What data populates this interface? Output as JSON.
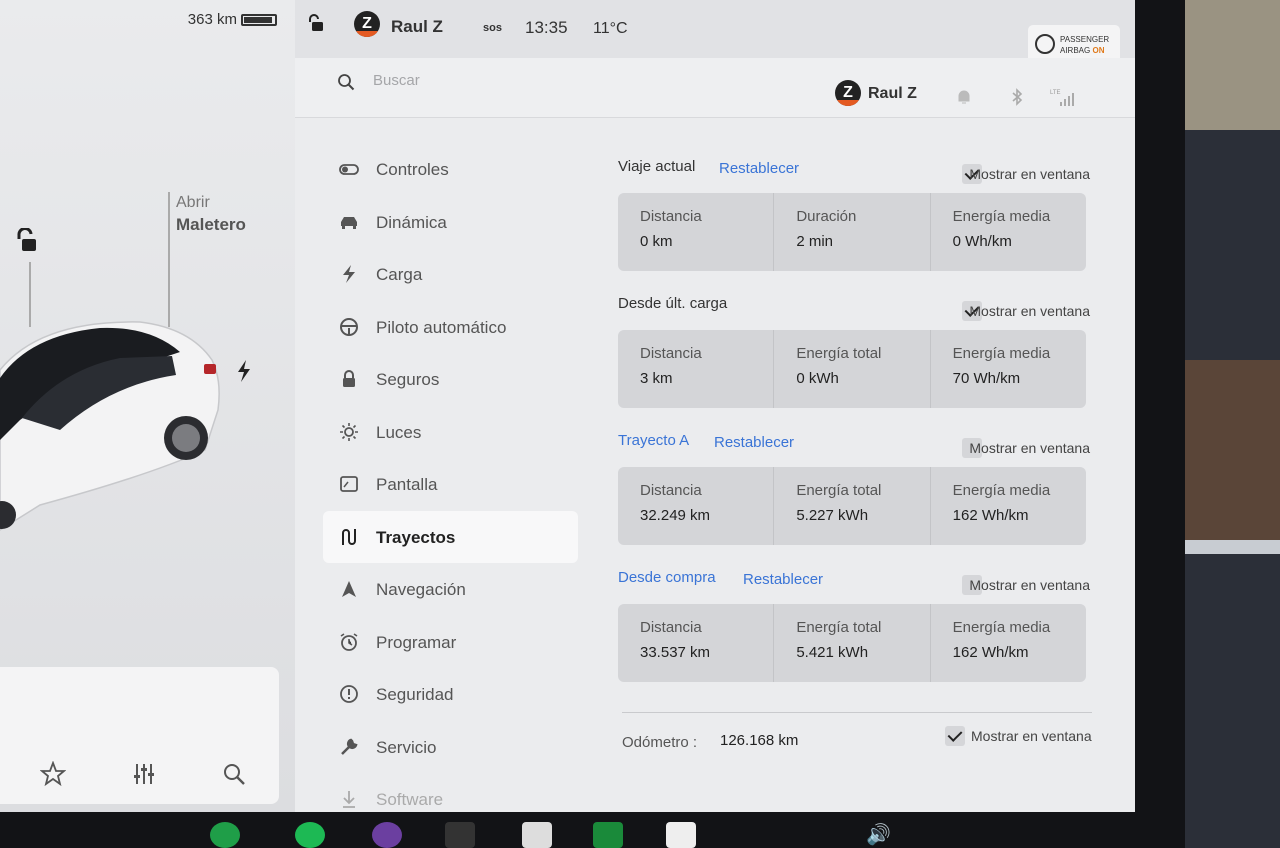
{
  "car_panel": {
    "range": "363 km",
    "trunk_label_top": "Abrir",
    "trunk_label_bottom": "Maletero"
  },
  "status_bar": {
    "user": "Raul Z",
    "sos": "sos",
    "time": "13:35",
    "temperature": "11°C",
    "airbag_line1": "PASSENGER",
    "airbag_line2": "AIRBAG",
    "airbag_state": "ON"
  },
  "search": {
    "placeholder": "Buscar",
    "user": "Raul Z",
    "signal_label": "LTE"
  },
  "nav": {
    "items": [
      {
        "label": "Controles",
        "icon": "toggle-icon"
      },
      {
        "label": "Dinámica",
        "icon": "car-icon"
      },
      {
        "label": "Carga",
        "icon": "bolt-icon"
      },
      {
        "label": "Piloto automático",
        "icon": "steering-wheel-icon"
      },
      {
        "label": "Seguros",
        "icon": "lock-icon"
      },
      {
        "label": "Luces",
        "icon": "light-icon"
      },
      {
        "label": "Pantalla",
        "icon": "display-icon"
      },
      {
        "label": "Trayectos",
        "icon": "trips-icon",
        "active": true
      },
      {
        "label": "Navegación",
        "icon": "navigation-icon"
      },
      {
        "label": "Programar",
        "icon": "alarm-clock-icon"
      },
      {
        "label": "Seguridad",
        "icon": "alert-icon"
      },
      {
        "label": "Servicio",
        "icon": "wrench-icon"
      },
      {
        "label": "Software",
        "icon": "download-icon"
      }
    ]
  },
  "trips": [
    {
      "title": "Viaje actual",
      "reset": "Restablecer",
      "show_label": "Mostrar en ventana",
      "show_checked": true,
      "stats": [
        {
          "label": "Distancia",
          "value": "0  km"
        },
        {
          "label": "Duración",
          "value": "2  min"
        },
        {
          "label": "Energía media",
          "value": "0  Wh/km"
        }
      ]
    },
    {
      "title": "Desde últ. carga",
      "show_label": "Mostrar en ventana",
      "show_checked": true,
      "stats": [
        {
          "label": "Distancia",
          "value": "3  km"
        },
        {
          "label": "Energía total",
          "value": "0  kWh"
        },
        {
          "label": "Energía media",
          "value": "70  Wh/km"
        }
      ]
    },
    {
      "title": "Trayecto A",
      "reset": "Restablecer",
      "show_label": "Mostrar en ventana",
      "show_checked": false,
      "stats": [
        {
          "label": "Distancia",
          "value": "32.249  km"
        },
        {
          "label": "Energía total",
          "value": "5.227  kWh"
        },
        {
          "label": "Energía media",
          "value": "162  Wh/km"
        }
      ]
    },
    {
      "title": "Desde compra",
      "reset": "Restablecer",
      "show_label": "Mostrar en ventana",
      "show_checked": false,
      "stats": [
        {
          "label": "Distancia",
          "value": "33.537  km"
        },
        {
          "label": "Energía total",
          "value": "5.421  kWh"
        },
        {
          "label": "Energía media",
          "value": "162  Wh/km"
        }
      ]
    }
  ],
  "odometer": {
    "label": "Odómetro  :",
    "value": "126.168  km",
    "show_label": "Mostrar en ventana",
    "show_checked": true
  },
  "colors": {
    "accent_blue": "#3a74d6",
    "airbag_on": "#e07a1b"
  }
}
